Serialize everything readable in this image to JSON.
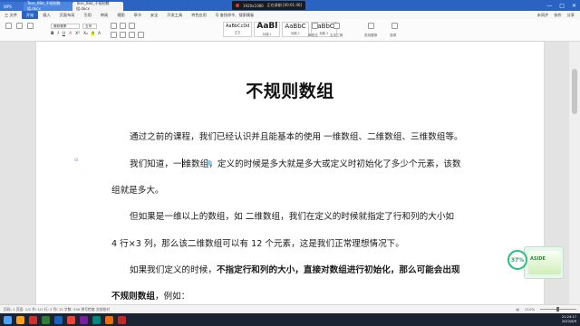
{
  "window": {
    "tabs": [
      "WPS",
      "Tese_0Bd_不规则数组.docx",
      "Tese_0Bd_不规则数组.docx"
    ],
    "recorder": {
      "resolution": "1920x1080",
      "status": "正在录制 [00:01:46]"
    }
  },
  "menu": {
    "items": [
      "三 文件",
      "开始",
      "插入",
      "页面布局",
      "引用",
      "审阅",
      "视图",
      "章节",
      "安全",
      "开发工具",
      "特色应用",
      "Q 查找命令、搜索模板"
    ],
    "active_index": 1,
    "right": [
      "未同步",
      "协作",
      "分享"
    ]
  },
  "ribbon": {
    "font_name": "微软雅黑",
    "font_size": "五号",
    "format_buttons": [
      "B",
      "I",
      "U",
      "A",
      "X²",
      "X₂",
      "A",
      "A"
    ],
    "styles": [
      {
        "sample": "AaBbCcDd",
        "label": "正文"
      },
      {
        "sample": "AaBl",
        "label": "标题 1"
      },
      {
        "sample": "AaBbC",
        "label": "标题 2"
      },
      {
        "sample": "AaBbC",
        "label": "标题 3"
      }
    ],
    "right_tools": [
      "新样式",
      "文字工具",
      "查找替换",
      "选择"
    ]
  },
  "document": {
    "title": "不规则数组",
    "paragraphs": [
      "通过之前的课程，我们已经认识并且能基本的使用 一维数组、二维数组、三维数组等。",
      "我们知道，一",
      "维数组，定义的时候是多大就是多大或定义时初始化了多少个元素，该数",
      "组就是多大。",
      "但如果是一维以上的数组，如  二维数组，我们在定义的时候就指定了行和列的大小如",
      "4 行×3 列，那么该二维数组可以有  12  个元素，这是我们正常理想情况下。",
      "如果我们定义的时候，",
      "不指定行和列的大小，直接对数组进行初始化，那么可能会出现",
      "不规则数组",
      "，例如："
    ]
  },
  "widget": {
    "percent": "37%",
    "ad_text": "ASIDE"
  },
  "status": {
    "left": "页码: 1  页面: 1/2  节: 1/1  行: 2  列: 12  字数: 330  拼写检查  文档校对",
    "zoom": "210%"
  },
  "taskbar": {
    "clock_time": "21:24:17",
    "clock_date": "2022/6/9"
  },
  "colors": {
    "accent": "#2a63c2",
    "taskbar": "#1c2433",
    "widget_green": "#25c07b"
  }
}
